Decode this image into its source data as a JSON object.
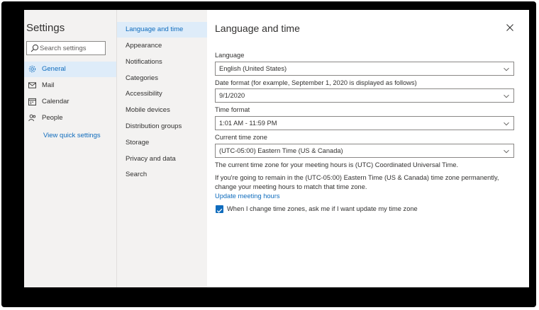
{
  "app": {
    "title": "Settings"
  },
  "search": {
    "placeholder": "Search settings"
  },
  "nav": [
    {
      "label": "General",
      "icon": "gear-icon"
    },
    {
      "label": "Mail",
      "icon": "mail-icon"
    },
    {
      "label": "Calendar",
      "icon": "calendar-icon"
    },
    {
      "label": "People",
      "icon": "people-icon"
    }
  ],
  "quick_settings_link": "View quick settings",
  "subnav": [
    "Language and time",
    "Appearance",
    "Notifications",
    "Categories",
    "Accessibility",
    "Mobile devices",
    "Distribution groups",
    "Storage",
    "Privacy and data",
    "Search"
  ],
  "content": {
    "title": "Language and time",
    "language": {
      "label": "Language",
      "value": "English (United States)"
    },
    "date_format": {
      "label": "Date format (for example, September 1, 2020 is displayed as follows)",
      "value": "9/1/2020"
    },
    "time_format": {
      "label": "Time format",
      "value": "1:01 AM - 11:59 PM"
    },
    "time_zone": {
      "label": "Current time zone",
      "value": "(UTC-05:00) Eastern Time (US & Canada)"
    },
    "meeting_info": "The current time zone for your meeting hours is (UTC) Coordinated Universal Time.",
    "meeting_advice": "If you're going to remain in the (UTC-05:00) Eastern Time (US & Canada) time zone permanently, change your meeting hours to match that time zone.",
    "update_link": "Update meeting hours",
    "checkbox": {
      "label": "When I change time zones, ask me if I want update my time zone",
      "checked": true
    }
  },
  "colors": {
    "accent": "#0f6cbd",
    "selected_bg": "#deecf9",
    "nav_bg": "#f3f2f1"
  }
}
